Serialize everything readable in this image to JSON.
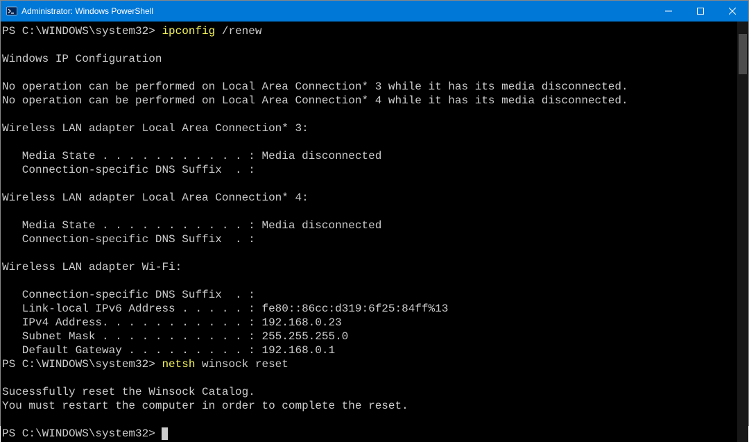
{
  "window": {
    "title": "Administrator: Windows PowerShell"
  },
  "terminal": {
    "prompt1": "PS C:\\WINDOWS\\system32> ",
    "cmd1a": "ipconfig ",
    "cmd1b": "/renew",
    "blank": "",
    "header": "Windows IP Configuration",
    "err1": "No operation can be performed on Local Area Connection* 3 while it has its media disconnected.",
    "err2": "No operation can be performed on Local Area Connection* 4 while it has its media disconnected.",
    "adapter3_title": "Wireless LAN adapter Local Area Connection* 3:",
    "adapter3_media": "   Media State . . . . . . . . . . . : Media disconnected",
    "adapter3_dns": "   Connection-specific DNS Suffix  . :",
    "adapter4_title": "Wireless LAN adapter Local Area Connection* 4:",
    "adapter4_media": "   Media State . . . . . . . . . . . : Media disconnected",
    "adapter4_dns": "   Connection-specific DNS Suffix  . :",
    "wifi_title": "Wireless LAN adapter Wi-Fi:",
    "wifi_dns": "   Connection-specific DNS Suffix  . :",
    "wifi_ipv6": "   Link-local IPv6 Address . . . . . : fe80::86cc:d319:6f25:84ff%13",
    "wifi_ipv4": "   IPv4 Address. . . . . . . . . . . : 192.168.0.23",
    "wifi_mask": "   Subnet Mask . . . . . . . . . . . : 255.255.255.0",
    "wifi_gateway": "   Default Gateway . . . . . . . . . : 192.168.0.1",
    "prompt2": "PS C:\\WINDOWS\\system32> ",
    "cmd2a": "netsh ",
    "cmd2b": "winsock reset",
    "success1": "Sucessfully reset the Winsock Catalog.",
    "success2": "You must restart the computer in order to complete the reset.",
    "prompt3": "PS C:\\WINDOWS\\system32> "
  }
}
